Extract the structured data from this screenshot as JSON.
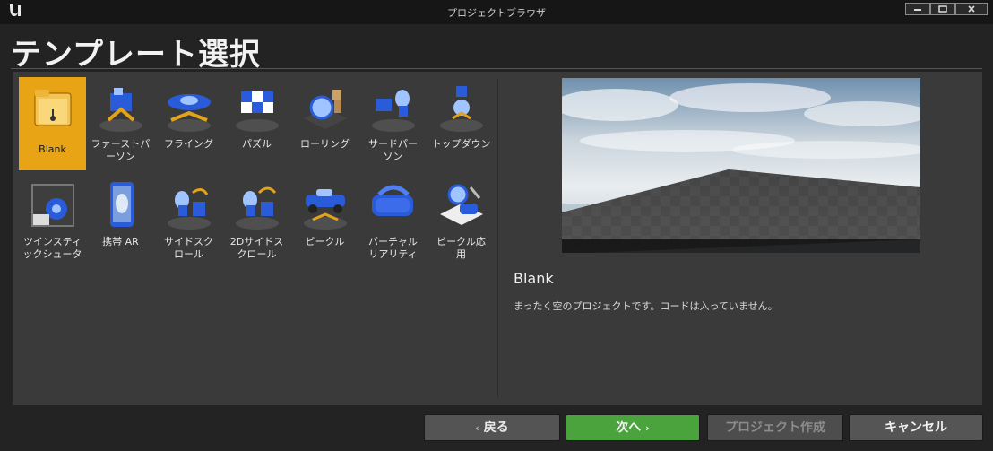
{
  "window": {
    "title": "プロジェクトブラウザ"
  },
  "header": {
    "title": "テンプレート選択"
  },
  "templates": [
    {
      "label": "Blank",
      "icon": "blank-folder-icon",
      "selected": true
    },
    {
      "label": "ファーストパ\nーソン",
      "icon": "first-person-icon"
    },
    {
      "label": "フライング",
      "icon": "flying-icon"
    },
    {
      "label": "パズル",
      "icon": "puzzle-icon"
    },
    {
      "label": "ローリング",
      "icon": "rolling-icon"
    },
    {
      "label": "サードパー\nソン",
      "icon": "third-person-icon"
    },
    {
      "label": "トップダウン",
      "icon": "top-down-icon"
    },
    {
      "label": "ツインスティ\nックシュータ",
      "icon": "twin-stick-icon"
    },
    {
      "label": "携帯 AR",
      "icon": "handheld-ar-icon"
    },
    {
      "label": "サイドスク\nロール",
      "icon": "side-scroll-icon"
    },
    {
      "label": "2Dサイドス\nクロール",
      "icon": "2d-side-scroll-icon"
    },
    {
      "label": "ビークル",
      "icon": "vehicle-icon"
    },
    {
      "label": "バーチャル\nリアリティ",
      "icon": "vr-headset-icon"
    },
    {
      "label": "ビークル応\n用",
      "icon": "vehicle-advanced-icon"
    }
  ],
  "preview": {
    "name": "Blank",
    "description": "まったく空のプロジェクトです。コードは入っていません。"
  },
  "buttons": {
    "back": "戻る",
    "next": "次へ",
    "create": "プロジェクト作成",
    "cancel": "キャンセル"
  },
  "colors": {
    "selected": "#e8a414",
    "next_button": "#4aa33d"
  }
}
